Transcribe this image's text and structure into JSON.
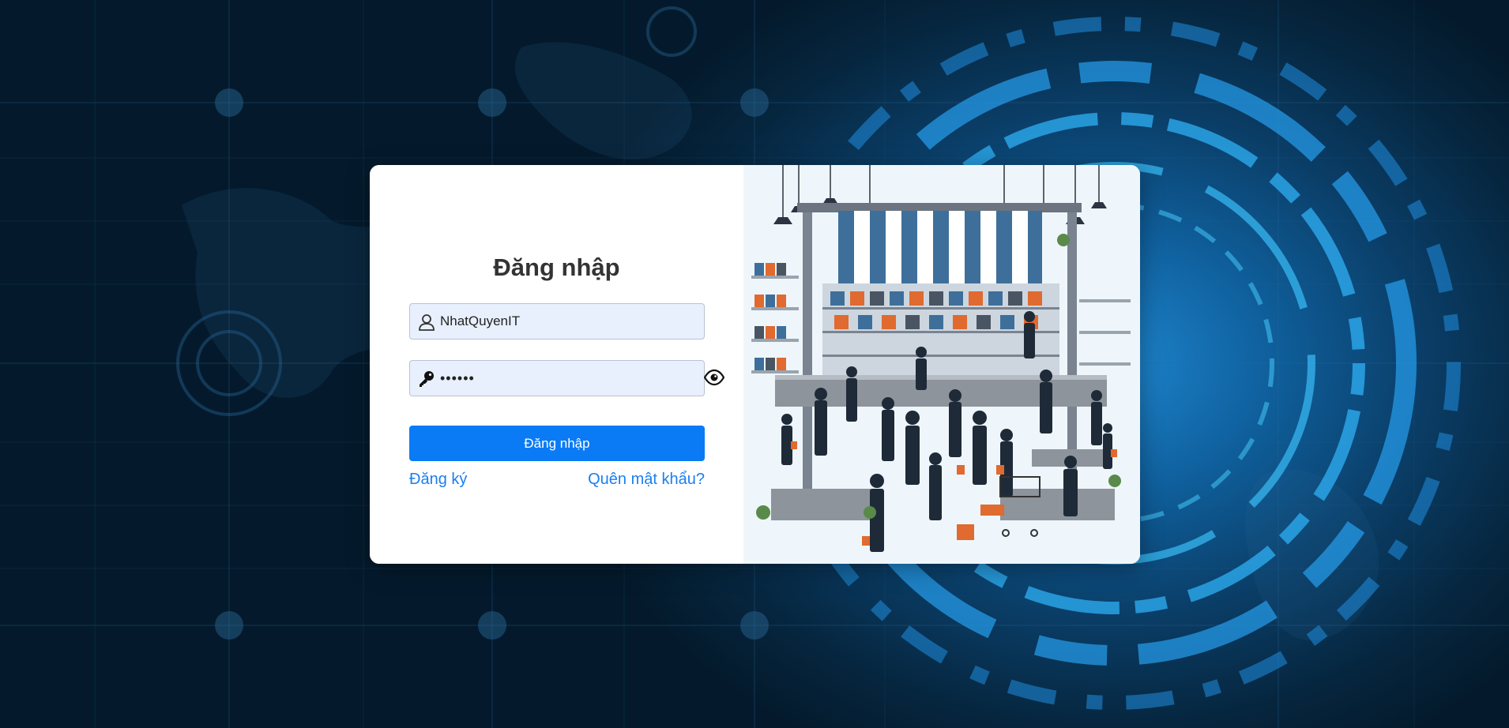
{
  "login": {
    "title": "Đăng nhập",
    "username_value": "NhatQuyenIT",
    "password_value": "••••••",
    "submit_label": "Đăng nhập",
    "register_link": "Đăng ký",
    "forgot_link": "Quên mật khẩu?"
  },
  "icons": {
    "username": "user-icon",
    "password": "key-icon",
    "toggle_password": "eye-icon"
  },
  "colors": {
    "primary_button": "#0b7bf5",
    "link": "#1a7ff0",
    "input_background": "#e8f0fe",
    "background_dark": "#041a2c",
    "background_glow": "#1e86cf"
  }
}
